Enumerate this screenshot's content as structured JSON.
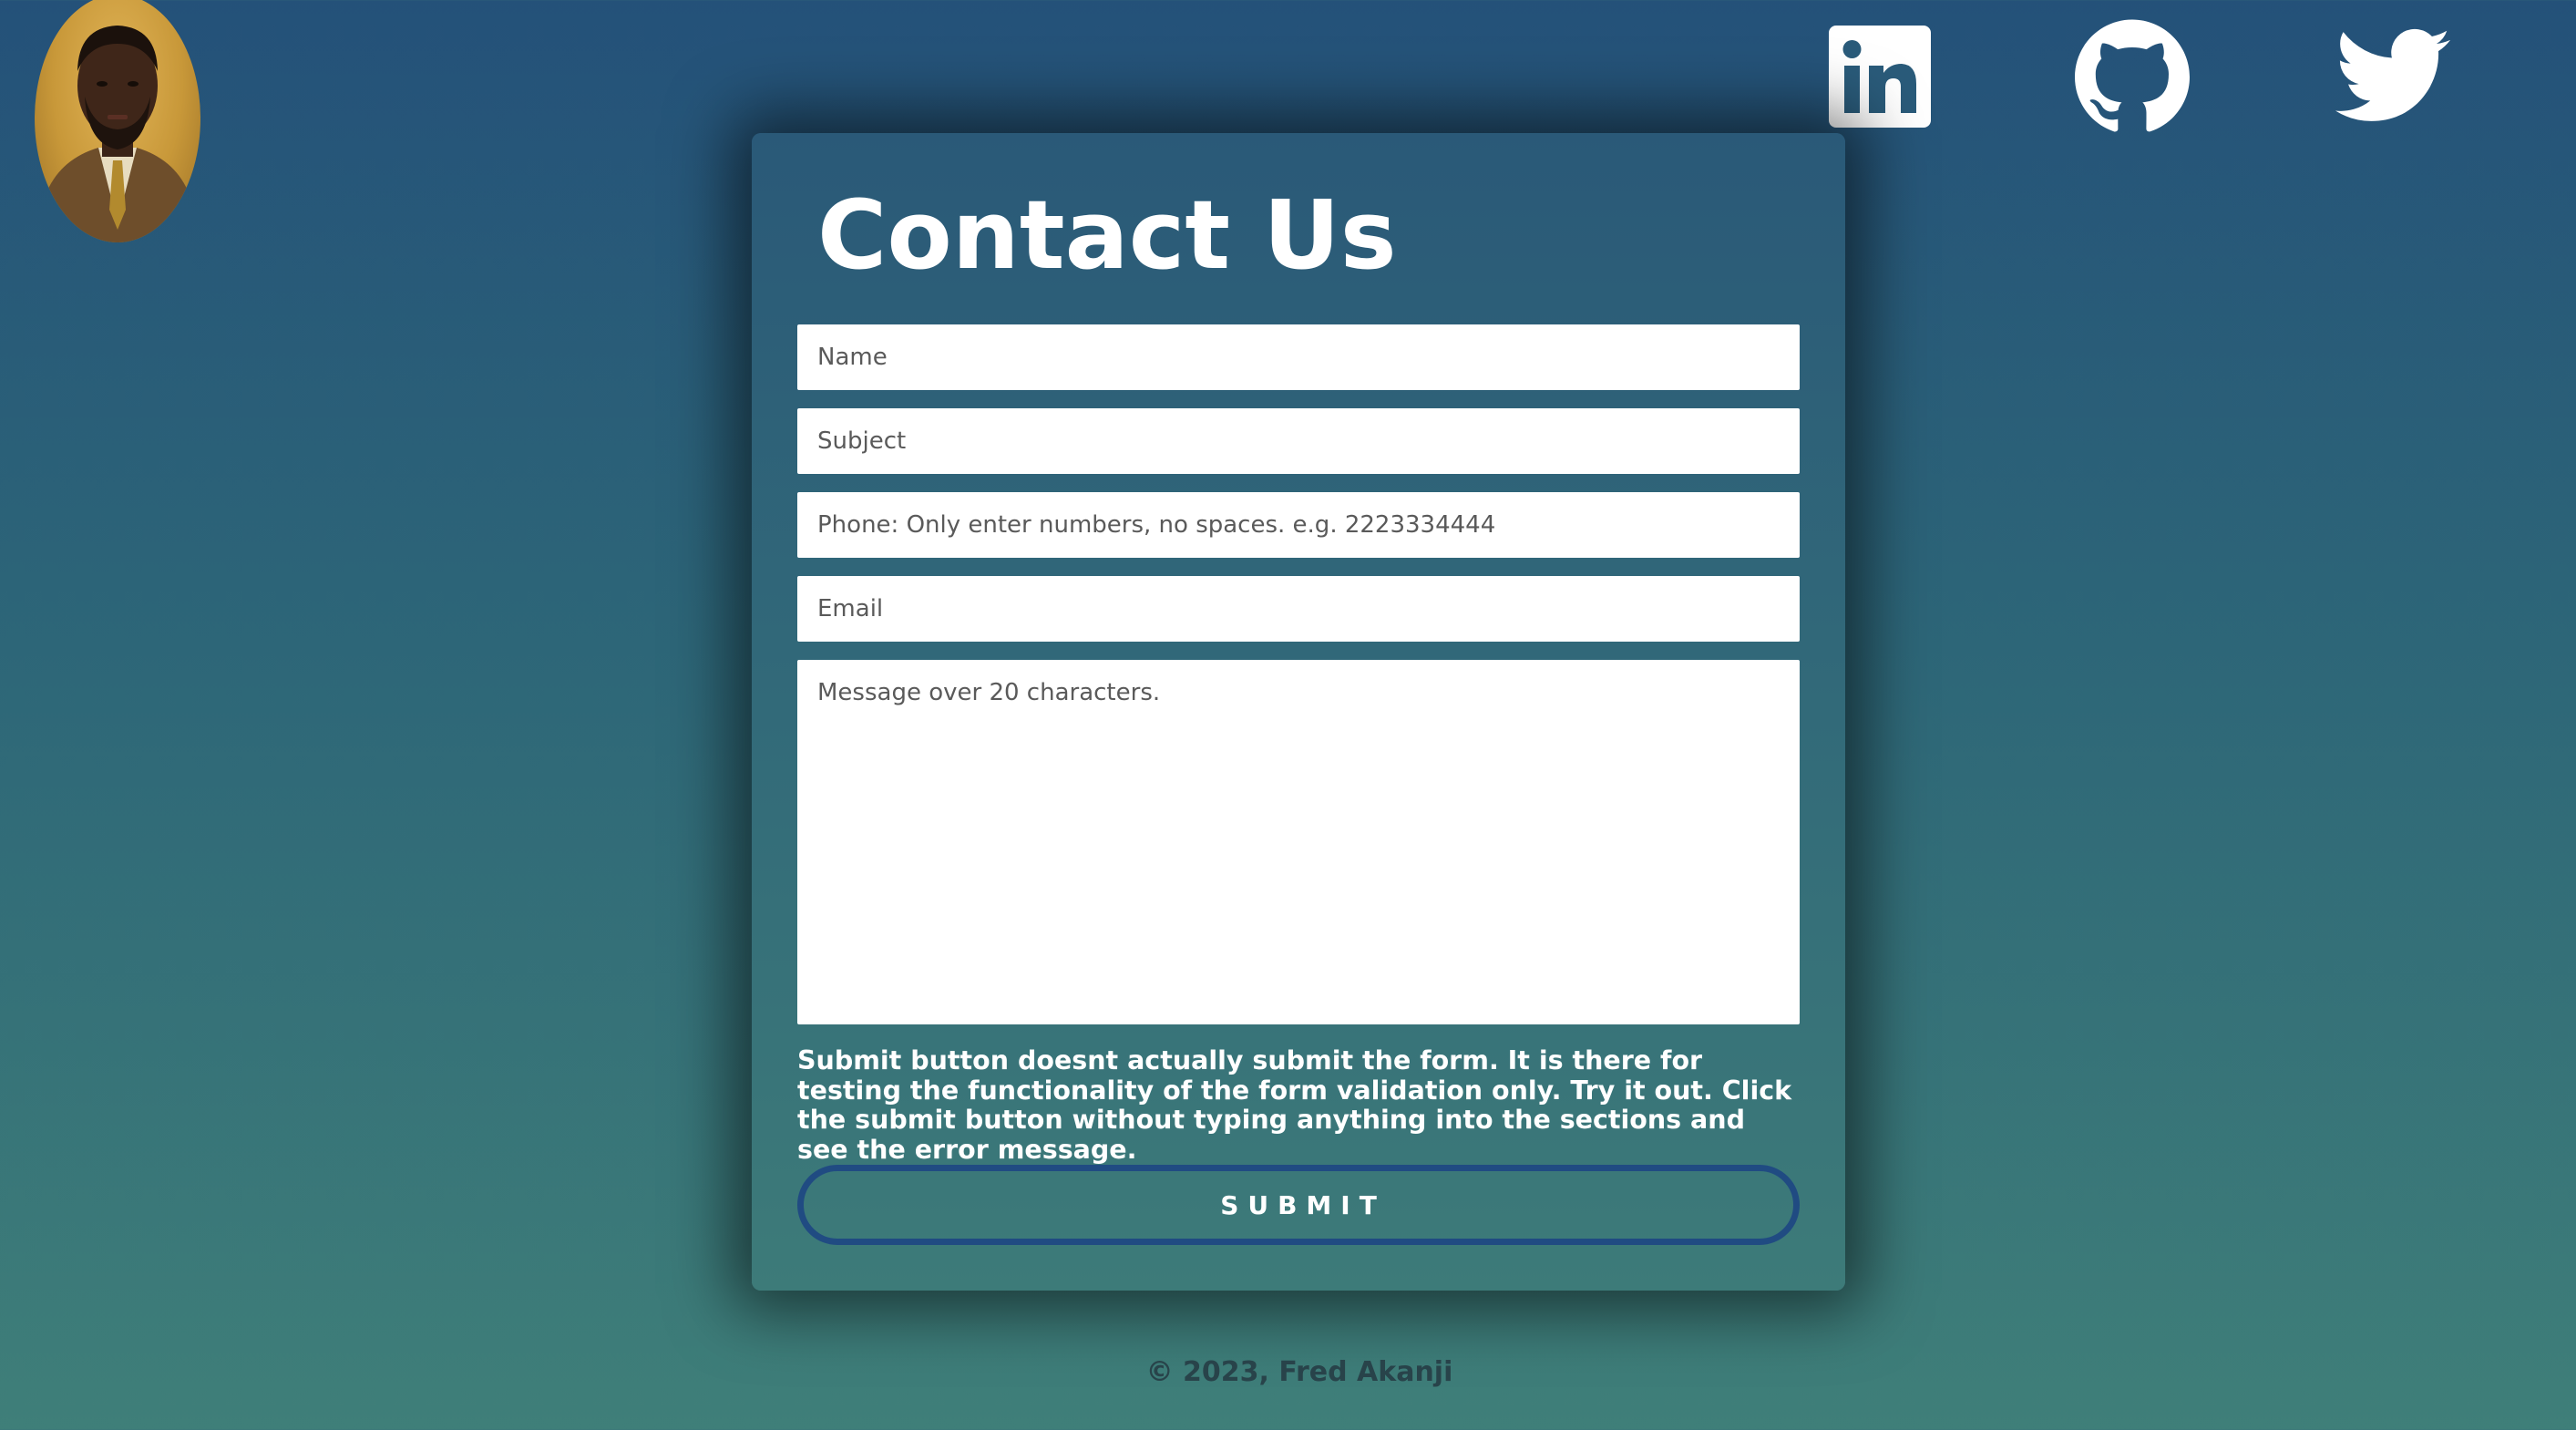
{
  "avatar": {
    "alt": "Fred Akanji"
  },
  "social": {
    "items": [
      {
        "name": "linkedin",
        "icon": "linkedin-icon"
      },
      {
        "name": "github",
        "icon": "github-icon"
      },
      {
        "name": "twitter",
        "icon": "twitter-icon"
      }
    ],
    "icon_color": "#ffffff"
  },
  "form": {
    "title": "Contact Us",
    "fields": {
      "name": {
        "placeholder": "Name",
        "value": ""
      },
      "subject": {
        "placeholder": "Subject",
        "value": ""
      },
      "phone": {
        "placeholder": "Phone: Only enter numbers, no spaces. e.g. 2223334444",
        "value": ""
      },
      "email": {
        "placeholder": "Email",
        "value": ""
      },
      "message": {
        "placeholder": "Message over 20 characters.",
        "value": ""
      }
    },
    "note": "Submit button doesnt actually submit the form. It is there for testing the functionality of the form validation only. Try it out. Click the submit button without typing anything into the sections and see the error message.",
    "submit_label": "SUBMIT"
  },
  "footer": {
    "text": "© 2023, Fred Akanji"
  },
  "colors": {
    "background_top": "#245179",
    "background_bottom": "#3f7f79",
    "card_top": "#2a5978",
    "card_bottom": "#3d7b79",
    "submit_border": "#204b82",
    "footer_text": "#28434a"
  }
}
